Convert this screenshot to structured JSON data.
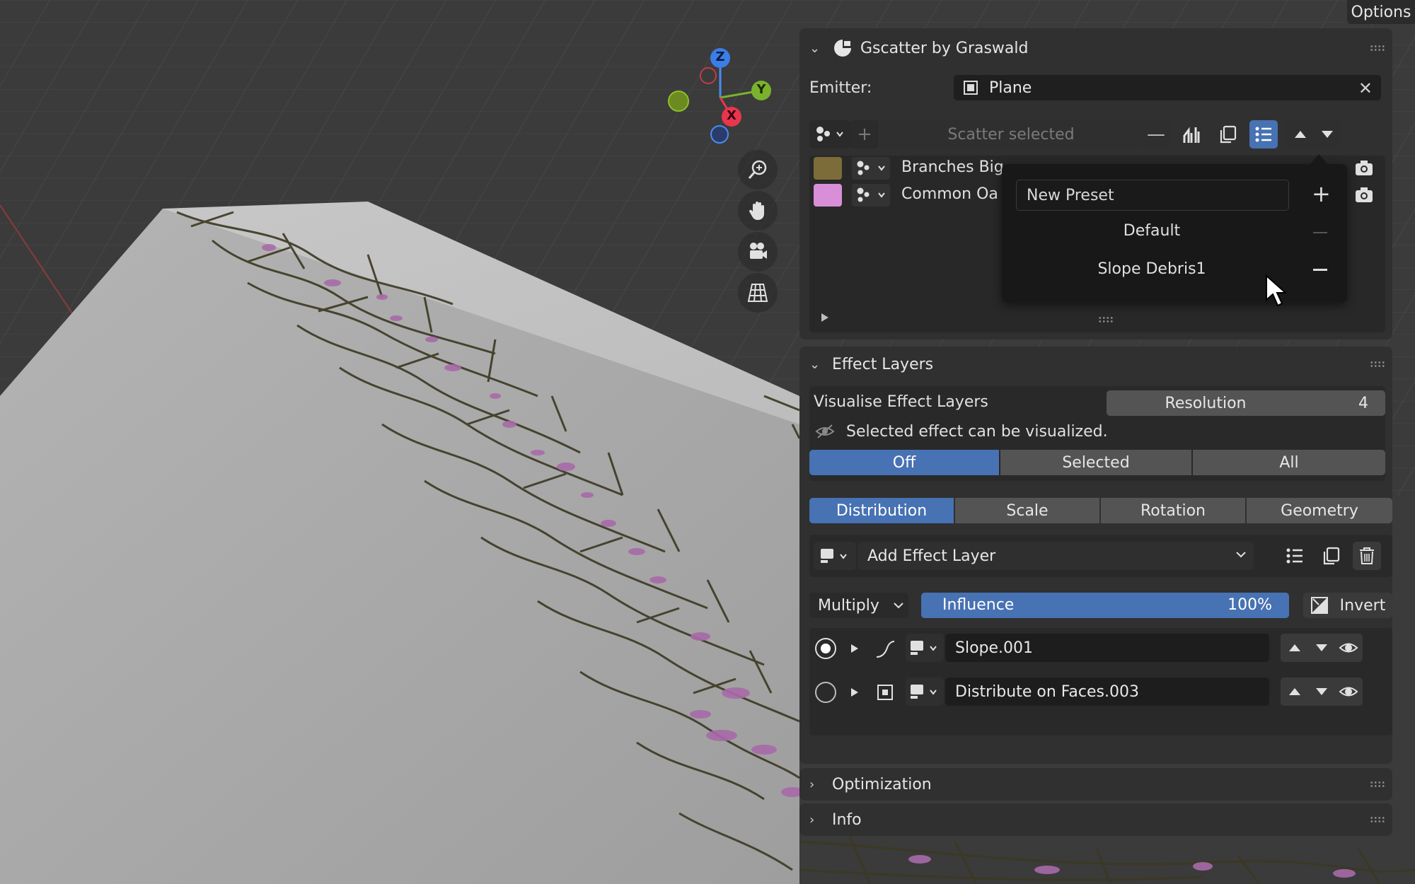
{
  "options_label": "Options",
  "gizmo": {
    "z": "Z",
    "y": "Y",
    "x": "X"
  },
  "nav_icons": [
    "zoom-icon",
    "hand-icon",
    "camera-icon",
    "grid-icon"
  ],
  "gscatter": {
    "title": "Gscatter by Graswald",
    "emitter_label": "Emitter:",
    "emitter_value": "Plane",
    "scatter_button": "Scatter selected",
    "layers": [
      {
        "name": "Branches Big",
        "color": "#7c6c39"
      },
      {
        "name": "Common Oa",
        "color": "#d88fd8"
      }
    ],
    "preset_menu": {
      "new_preset_placeholder": "New Preset",
      "items": [
        "Default",
        "Slope Debris1"
      ]
    }
  },
  "effect_layers": {
    "title": "Effect Layers",
    "visualise_label": "Visualise Effect Layers",
    "resolution_label": "Resolution",
    "resolution_value": "4",
    "info_text": "Selected effect can be visualized.",
    "visualise_modes": [
      "Off",
      "Selected",
      "All"
    ],
    "active_mode": "Off",
    "tabs": [
      "Distribution",
      "Scale",
      "Rotation",
      "Geometry"
    ],
    "active_tab": "Distribution",
    "add_effect_label": "Add Effect Layer",
    "blend_mode": "Multiply",
    "influence_label": "Influence",
    "influence_value": "100%",
    "influence_fraction": 1.0,
    "invert_label": "Invert",
    "effects": [
      {
        "name": "Slope.001",
        "selected": true,
        "icon": "curve-icon"
      },
      {
        "name": "Distribute on Faces.003",
        "selected": false,
        "icon": "face-icon"
      }
    ]
  },
  "optimization": {
    "title": "Optimization"
  },
  "info": {
    "title": "Info"
  },
  "colors": {
    "accent": "#4772b3",
    "panel": "#303030",
    "field": "#1d1d1d",
    "button": "#545454"
  }
}
